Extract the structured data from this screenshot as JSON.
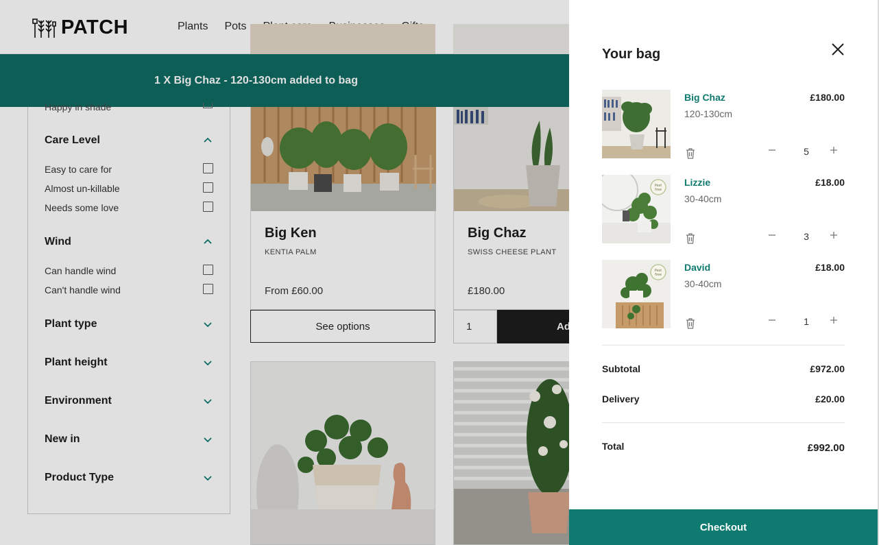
{
  "header": {
    "logo_text": "PATCH",
    "nav": [
      "Plants",
      "Pots",
      "Plant care",
      "Businesses",
      "Gifts"
    ]
  },
  "banner": {
    "text": "1 X Big Chaz - 120-130cm added to bag"
  },
  "filters": {
    "cut_off_option": "Happy in shade",
    "groups": [
      {
        "title": "Care Level",
        "expanded": true,
        "options": [
          "Easy to care for",
          "Almost un-killable",
          "Needs some love"
        ]
      },
      {
        "title": "Wind",
        "expanded": true,
        "options": [
          "Can handle wind",
          "Can't handle wind"
        ]
      },
      {
        "title": "Plant type",
        "expanded": false
      },
      {
        "title": "Plant height",
        "expanded": false
      },
      {
        "title": "Environment",
        "expanded": false
      },
      {
        "title": "New in",
        "expanded": false
      },
      {
        "title": "Product Type",
        "expanded": false
      }
    ]
  },
  "products": [
    {
      "name": "Big Ken",
      "subtitle": "KENTIA PALM",
      "price": "From £60.00",
      "action": "See options"
    },
    {
      "name": "Big Chaz",
      "subtitle": "SWISS CHEESE PLANT",
      "price": "£180.00",
      "quantity": "1",
      "action": "Ad"
    }
  ],
  "bag": {
    "title": "Your bag",
    "items": [
      {
        "name": "Big Chaz",
        "size": "120-130cm",
        "price": "£180.00",
        "qty": "5"
      },
      {
        "name": "Lizzie",
        "size": "30-40cm",
        "price": "£18.00",
        "qty": "3",
        "badge": "Pest free"
      },
      {
        "name": "David",
        "size": "30-40cm",
        "price": "£18.00",
        "qty": "1",
        "badge": "Pest free"
      }
    ],
    "subtotal_label": "Subtotal",
    "subtotal": "£972.00",
    "delivery_label": "Delivery",
    "delivery": "£20.00",
    "total_label": "Total",
    "total": "£992.00",
    "checkout_label": "Checkout"
  },
  "colors": {
    "brand_teal": "#0f7a6f",
    "banner_teal": "#0f6b62",
    "dark_button": "#1d1d1d"
  }
}
